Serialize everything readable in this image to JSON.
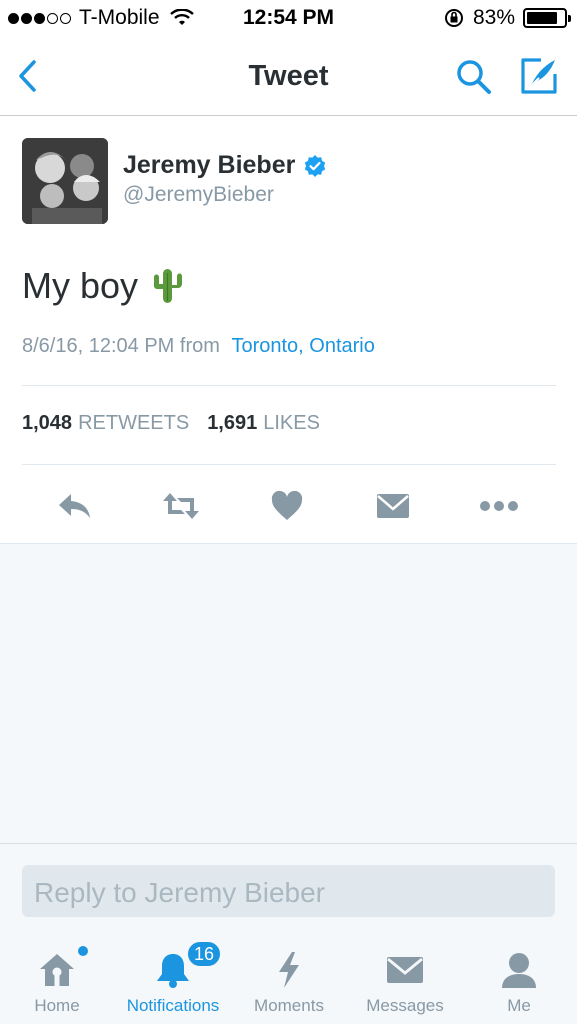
{
  "status_bar": {
    "carrier": "T-Mobile",
    "time": "12:54 PM",
    "battery": "83%",
    "battery_level": 0.83
  },
  "nav": {
    "title": "Tweet"
  },
  "tweet": {
    "author_name": "Jeremy Bieber",
    "author_handle": "@JeremyBieber",
    "text": "My boy",
    "emoji": "🌵",
    "timestamp": "8/6/16, 12:04 PM",
    "from_label": "from",
    "location": "Toronto, Ontario",
    "retweets_count": "1,048",
    "retweets_label": "RETWEETS",
    "likes_count": "1,691",
    "likes_label": "LIKES"
  },
  "reply": {
    "placeholder": "Reply to Jeremy Bieber"
  },
  "tabs": [
    {
      "label": "Home",
      "icon": "home-icon"
    },
    {
      "label": "Notifications",
      "icon": "bell-icon",
      "badge": "16"
    },
    {
      "label": "Moments",
      "icon": "lightning-icon"
    },
    {
      "label": "Messages",
      "icon": "envelope-icon"
    },
    {
      "label": "Me",
      "icon": "person-icon"
    }
  ],
  "colors": {
    "accent": "#1b95e0",
    "gray": "#8899a6",
    "text": "#292f33"
  }
}
